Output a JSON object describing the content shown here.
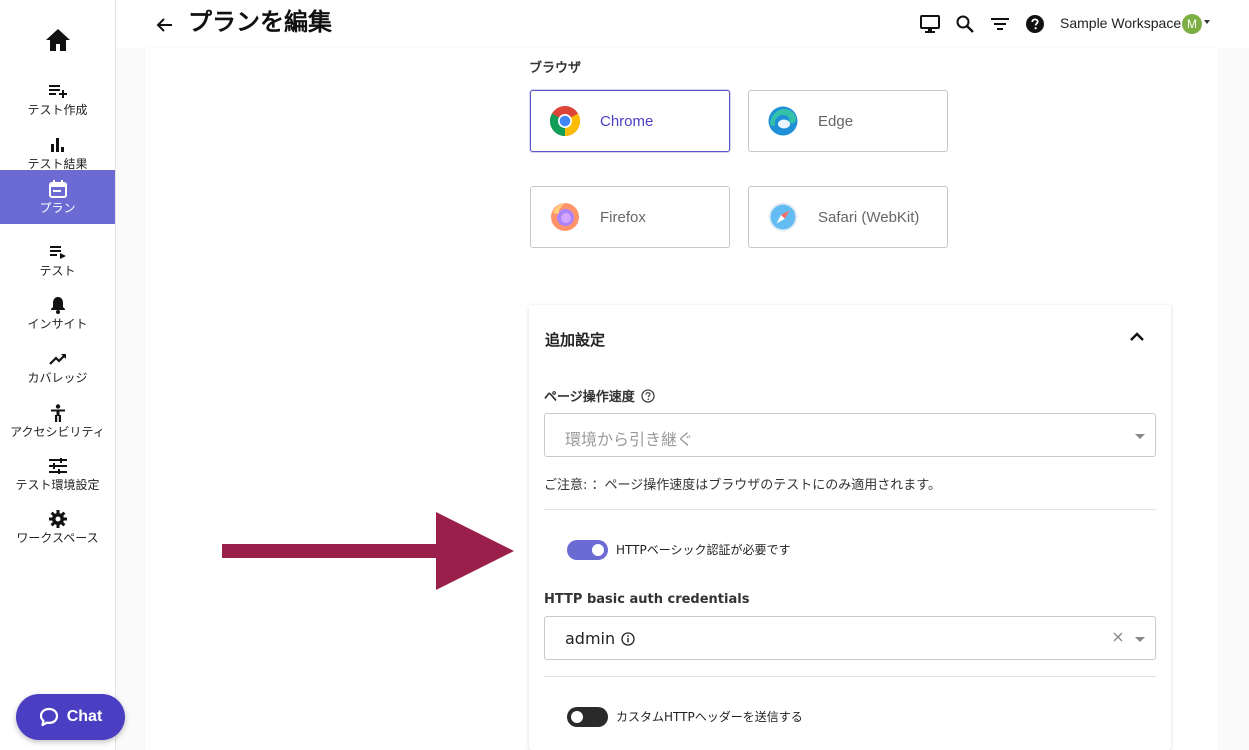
{
  "colors": {
    "accent": "#6c6bd3",
    "brand": "#4a3fc2",
    "arrow": "#9b1f4b",
    "toggle_off": "#2a2a2a",
    "avatar": "#7dae43"
  },
  "header": {
    "title": "プランを編集",
    "workspace": "Sample Workspace",
    "avatar_initial": "M",
    "icons": [
      "monitor-icon",
      "search-icon",
      "filter-icon",
      "help-icon"
    ]
  },
  "sidebar": {
    "items": [
      {
        "label": "テスト作成",
        "icon": "playlist-add-icon"
      },
      {
        "label": "テスト結果",
        "icon": "bar-chart-icon"
      },
      {
        "label": "プラン",
        "icon": "calendar-icon",
        "active": true
      },
      {
        "label": "テスト",
        "icon": "playlist-play-icon"
      },
      {
        "label": "インサイト",
        "icon": "bell-icon"
      },
      {
        "label": "カバレッジ",
        "icon": "trending-up-icon"
      },
      {
        "label": "アクセシビリティ",
        "icon": "accessibility-icon"
      },
      {
        "label": "テスト環境設定",
        "icon": "sliders-icon"
      },
      {
        "label": "ワークスペース",
        "icon": "gear-icon"
      }
    ],
    "chat_label": "Chat"
  },
  "browsers": {
    "label": "ブラウザ",
    "options": [
      {
        "name": "Chrome",
        "selected": true
      },
      {
        "name": "Edge",
        "selected": false
      },
      {
        "name": "Firefox",
        "selected": false
      },
      {
        "name": "Safari (WebKit)",
        "selected": false
      }
    ]
  },
  "additional": {
    "title": "追加設定",
    "speed_label": "ページ操作速度",
    "speed_placeholder": "環境から引き継ぐ",
    "note": "ご注意: ：ページ操作速度はブラウザのテストにのみ適用されます。",
    "basic_auth_toggle": {
      "label": "HTTPベーシック認証が必要です",
      "on": true
    },
    "credentials_label": "HTTP basic auth credentials",
    "credentials_value": "admin",
    "custom_headers_toggle": {
      "label": "カスタムHTTPヘッダーを送信する",
      "on": false
    }
  }
}
